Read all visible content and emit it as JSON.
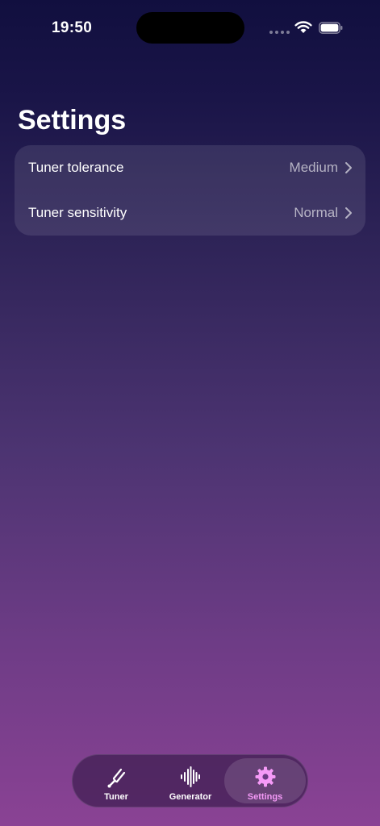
{
  "status_bar": {
    "time": "19:50"
  },
  "page": {
    "title": "Settings"
  },
  "settings": {
    "rows": [
      {
        "label": "Tuner tolerance",
        "value": "Medium"
      },
      {
        "label": "Tuner sensitivity",
        "value": "Normal"
      }
    ]
  },
  "tab_bar": {
    "tabs": [
      {
        "label": "Tuner",
        "icon": "tuning-fork-icon"
      },
      {
        "label": "Generator",
        "icon": "waveform-icon"
      },
      {
        "label": "Settings",
        "icon": "gear-icon",
        "selected": true
      }
    ],
    "accent_color": "#f59af7"
  }
}
